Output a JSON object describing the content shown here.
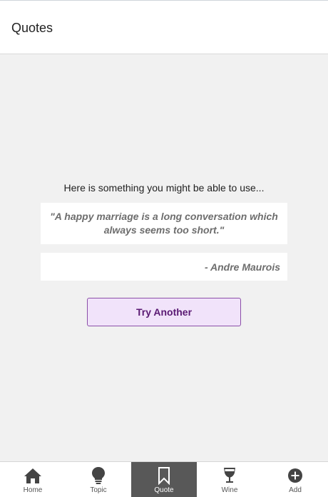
{
  "header": {
    "title": "Quotes"
  },
  "main": {
    "intro": "Here is something you might be able to use...",
    "quote": "\"A happy marriage is a long conversation which always seems too short.\"",
    "author": "- Andre Maurois",
    "try_button": "Try Another"
  },
  "tabs": [
    {
      "label": "Home",
      "icon": "home-icon"
    },
    {
      "label": "Topic",
      "icon": "lightbulb-icon"
    },
    {
      "label": "Quote",
      "icon": "bookmark-icon",
      "active": true
    },
    {
      "label": "Wine",
      "icon": "wine-glass-icon"
    },
    {
      "label": "Add",
      "icon": "plus-circle-icon"
    }
  ],
  "colors": {
    "content_bg": "#f1f1f1",
    "button_bg": "#f1e3fa",
    "button_border": "#8b4fa8",
    "button_text": "#5a1a73",
    "active_tab_bg": "#585858"
  }
}
